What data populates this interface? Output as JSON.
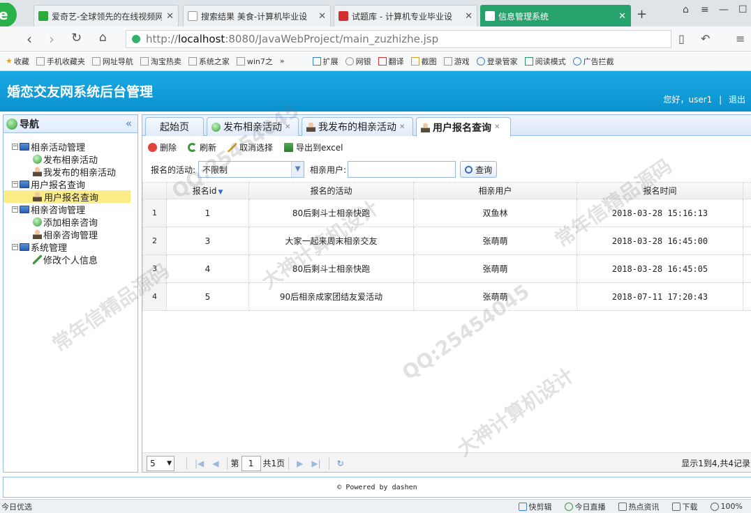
{
  "browser": {
    "tabs": [
      {
        "title": "爱奇艺-全球领先的在线视频网",
        "favicon_color": "#2eaa3a"
      },
      {
        "title": "搜索结果 美食-计算机毕业设",
        "favicon_color": "#cccccc"
      },
      {
        "title": "试题库 - 计算机专业毕业设",
        "favicon_color": "#d32f2f"
      },
      {
        "title": "信息管理系统",
        "favicon_color": "#ffffff"
      }
    ],
    "url_prefix": "http://",
    "url_host": "localhost",
    "url_rest": ":8080/JavaWebProject/main_zuzhizhe.jsp",
    "bookmarks": [
      "收藏",
      "手机收藏夹",
      "网址导航",
      "淘宝热卖",
      "系统之家",
      "win7之",
      "»",
      "扩展",
      "网银",
      "翻译",
      "截图",
      "游戏",
      "登录管家",
      "阅读模式",
      "广告拦截"
    ]
  },
  "app": {
    "title": "婚恋交友网系统后台管理",
    "greeting": "您好，user1",
    "separator": "|",
    "logout": "退出"
  },
  "nav": {
    "title": "导航",
    "collapse": "«",
    "tree": [
      {
        "label": "相亲活动管理",
        "level": 0,
        "icon": "computer-icon"
      },
      {
        "label": "发布相亲活动",
        "level": 1,
        "icon": "add-icon"
      },
      {
        "label": "我发布的相亲活动",
        "level": 1,
        "icon": "user-icon"
      },
      {
        "label": "用户报名查询",
        "level": 0,
        "icon": "computer-icon"
      },
      {
        "label": "用户报名查询",
        "level": 1,
        "icon": "user-icon",
        "selected": true
      },
      {
        "label": "相亲咨询管理",
        "level": 0,
        "icon": "computer-icon"
      },
      {
        "label": "添加相亲咨询",
        "level": 1,
        "icon": "add-icon"
      },
      {
        "label": "相亲咨询管理",
        "level": 1,
        "icon": "user-icon"
      },
      {
        "label": "系统管理",
        "level": 0,
        "icon": "computer-icon"
      },
      {
        "label": "修改个人信息",
        "level": 1,
        "icon": "edit-icon"
      }
    ]
  },
  "tabs": [
    {
      "label": "起始页",
      "icon": "",
      "closable": false
    },
    {
      "label": "发布相亲活动",
      "icon": "add-icon",
      "closable": true
    },
    {
      "label": "我发布的相亲活动",
      "icon": "user-icon",
      "closable": true
    },
    {
      "label": "用户报名查询",
      "icon": "user-icon",
      "closable": true,
      "active": true
    }
  ],
  "toolbar": {
    "delete": "删除",
    "refresh": "刷新",
    "cancel_select": "取消选择",
    "export": "导出到excel"
  },
  "filter": {
    "activity_label": "报名的活动:",
    "activity_value": "不限制",
    "user_label": "相亲用户:",
    "user_value": "",
    "query": "查询"
  },
  "grid": {
    "columns": [
      "报名id",
      "报名的活动",
      "相亲用户",
      "报名时间"
    ],
    "rows": [
      {
        "rownum": "1",
        "id": "1",
        "activity": "80后剩斗士相亲快跑",
        "user": "双鱼林",
        "time": "2018-03-28 15:16:13"
      },
      {
        "rownum": "2",
        "id": "3",
        "activity": "大家一起来周末相亲交友",
        "user": "张萌萌",
        "time": "2018-03-28 16:45:00"
      },
      {
        "rownum": "3",
        "id": "4",
        "activity": "80后剩斗士相亲快跑",
        "user": "张萌萌",
        "time": "2018-03-28 16:45:05"
      },
      {
        "rownum": "4",
        "id": "5",
        "activity": "90后相亲成家团结友爱活动",
        "user": "张萌萌",
        "time": "2018-07-11 17:20:43"
      }
    ]
  },
  "pager": {
    "page_size": "5",
    "page_prefix": "第",
    "page_value": "1",
    "page_suffix": "共1页",
    "info": "显示1到4,共4记录"
  },
  "footer": {
    "text": "© Powered by dashen"
  },
  "statusbar": [
    "今日优选",
    "快剪辑",
    "今日直播",
    "热点资讯",
    "下载",
    "100%"
  ],
  "watermarks": [
    "QQ:25454045",
    "常年信精品源码",
    "大神计算机设计"
  ]
}
